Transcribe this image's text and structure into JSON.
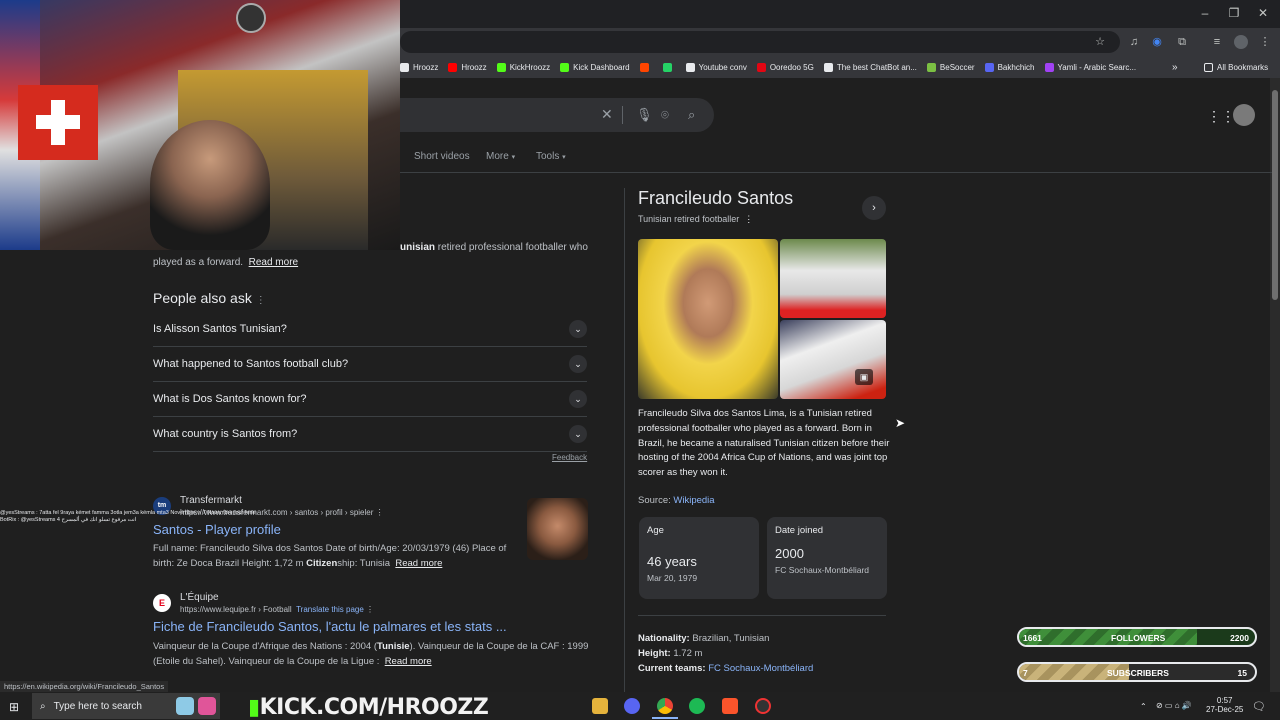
{
  "bookmarks": [
    {
      "label": "Hroozz",
      "color": "#e8eaed"
    },
    {
      "label": "Hroozz",
      "color": "#ff0000"
    },
    {
      "label": "KickHroozz",
      "color": "#53fc18"
    },
    {
      "label": "Kick Dashboard",
      "color": "#53fc18"
    },
    {
      "label": "",
      "color": "#ff4500"
    },
    {
      "label": "",
      "color": "#25d366"
    },
    {
      "label": "Youtube conv",
      "color": "#e8eaed"
    },
    {
      "label": "Ooredoo 5G",
      "color": "#e30613"
    },
    {
      "label": "The best ChatBot an...",
      "color": "#e8eaed"
    },
    {
      "label": "BeSoccer",
      "color": "#7bc043"
    },
    {
      "label": "Bakhchich",
      "color": "#5865f2"
    },
    {
      "label": "Yamli - Arabic Searc...",
      "color": "#a142f4"
    }
  ],
  "all_bookmarks": "All Bookmarks",
  "tabs": {
    "short_videos": "Short videos",
    "more": "More",
    "tools": "Tools"
  },
  "snippet": {
    "bold": "unisian",
    "line1_rest": " retired professional footballer who",
    "line2": "played as a forward.",
    "read_more": "Read more"
  },
  "paa": {
    "title": "People also ask",
    "questions": [
      "Is Alisson Santos Tunisian?",
      "What happened to Santos football club?",
      "What is Dos Santos known for?",
      "What country is Santos from?"
    ],
    "feedback": "Feedback"
  },
  "results": [
    {
      "site": "Transfermarkt",
      "url": "https://www.transfermarkt.com › santos › profil › spieler",
      "title": "Santos - Player profile",
      "line1": "Full name: Francileudo Silva dos Santos Date of birth/Age: 20/03/1979 (46) Place of",
      "line2a": "birth: Ze Doca Brazil Height: 1,72 m ",
      "line2b": "Citizen",
      "line2c": "ship: Tunisia",
      "read_more": "Read more"
    },
    {
      "site": "L'Équipe",
      "url": "https://www.lequipe.fr › Football",
      "translate": "Translate this page",
      "title": "Fiche de Francileudo Santos, l'actu le palmares et les stats ...",
      "line1a": "Vainqueur de la Coupe d'Afrique des Nations : 2004 (",
      "line1b": "Tunisie",
      "line1c": "). Vainqueur de la Coupe de la CAF : 1999",
      "line2": "(Etoile du Sahel). Vainqueur de la Coupe de la Ligue :",
      "read_more": "Read more"
    }
  ],
  "kp": {
    "title": "Francileudo Santos",
    "subtitle": "Tunisian retired footballer",
    "description": "Francileudo Silva dos Santos Lima, is a Tunisian retired professional footballer who played as a forward. Born in Brazil, he became a naturalised Tunisian citizen before their hosting of the 2004 Africa Cup of Nations, and was joint top scorer as they won it.",
    "source_label": "Source: ",
    "source_link": "Wikipedia",
    "age": {
      "label": "Age",
      "value": "46 years",
      "sub": "Mar 20, 1979"
    },
    "joined": {
      "label": "Date joined",
      "value": "2000",
      "sub": "FC Sochaux-Montbéliard"
    },
    "facts": [
      {
        "k": "Nationality:",
        "v": " Brazilian, Tunisian"
      },
      {
        "k": "Height:",
        "v": " 1.72 m"
      },
      {
        "k": "Current teams:",
        "v": " FC Sochaux-Montbéliard"
      }
    ]
  },
  "overlay": {
    "followers": {
      "current": "1661",
      "label": "FOLLOWERS",
      "goal": "2200",
      "progress": 0.755
    },
    "subscribers": {
      "current": "7",
      "label": "SUBSCRIBERS",
      "goal": "15",
      "progress": 0.467
    }
  },
  "status_url": "https://en.wikipedia.org/wiki/Francileudo_Santos",
  "chat": [
    "@yesStreams : 7atta fel 9raya kémet famma 3otla jem3a kémla mta3 Novembre w 7 Novembre jour ferie",
    "BotRix : @yesStreams 4 انت مرفوع تسلو انك في ألمسرح"
  ],
  "taskbar": {
    "search": "Type here to search",
    "kick": "KICK.COM/HROOZZ",
    "time": "0:57",
    "date": "27-Dec-25"
  }
}
